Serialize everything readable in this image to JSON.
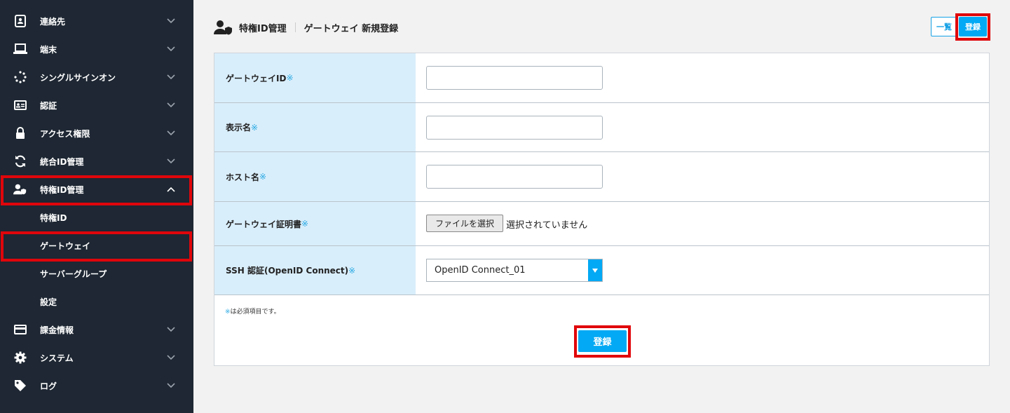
{
  "sidebar": {
    "items": [
      {
        "label": "連絡先",
        "icon": "contacts-icon"
      },
      {
        "label": "端末",
        "icon": "laptop-icon"
      },
      {
        "label": "シングルサインオン",
        "icon": "sso-icon"
      },
      {
        "label": "認証",
        "icon": "id-card-icon"
      },
      {
        "label": "アクセス権限",
        "icon": "lock-icon"
      },
      {
        "label": "統合ID管理",
        "icon": "sync-icon"
      },
      {
        "label": "特権ID管理",
        "icon": "privileged-user-icon"
      },
      {
        "label": "課金情報",
        "icon": "credit-card-icon"
      },
      {
        "label": "システム",
        "icon": "gear-icon"
      },
      {
        "label": "ログ",
        "icon": "tag-icon"
      }
    ],
    "subitems": [
      {
        "label": "特権ID"
      },
      {
        "label": "ゲートウェイ"
      },
      {
        "label": "サーバーグループ"
      },
      {
        "label": "設定"
      }
    ]
  },
  "header": {
    "title": "特権ID管理",
    "subtitle": "ゲートウェイ 新規登録",
    "list_button": "一覧",
    "register_button": "登録"
  },
  "form": {
    "required_mark": "※",
    "fields": [
      {
        "label": "ゲートウェイID",
        "value": ""
      },
      {
        "label": "表示名",
        "value": ""
      },
      {
        "label": "ホスト名",
        "value": ""
      },
      {
        "label": "ゲートウェイ証明書",
        "button": "ファイルを選択",
        "status": "選択されていません"
      },
      {
        "label": "SSH 認証(OpenID Connect)",
        "selected": "OpenID Connect_01"
      }
    ],
    "note": "は必須項目です。",
    "submit": "登録"
  },
  "colors": {
    "sidebar_bg": "#1e2733",
    "accent": "#03a9f4",
    "label_bg": "#d9eefb",
    "highlight": "#e0060b"
  }
}
